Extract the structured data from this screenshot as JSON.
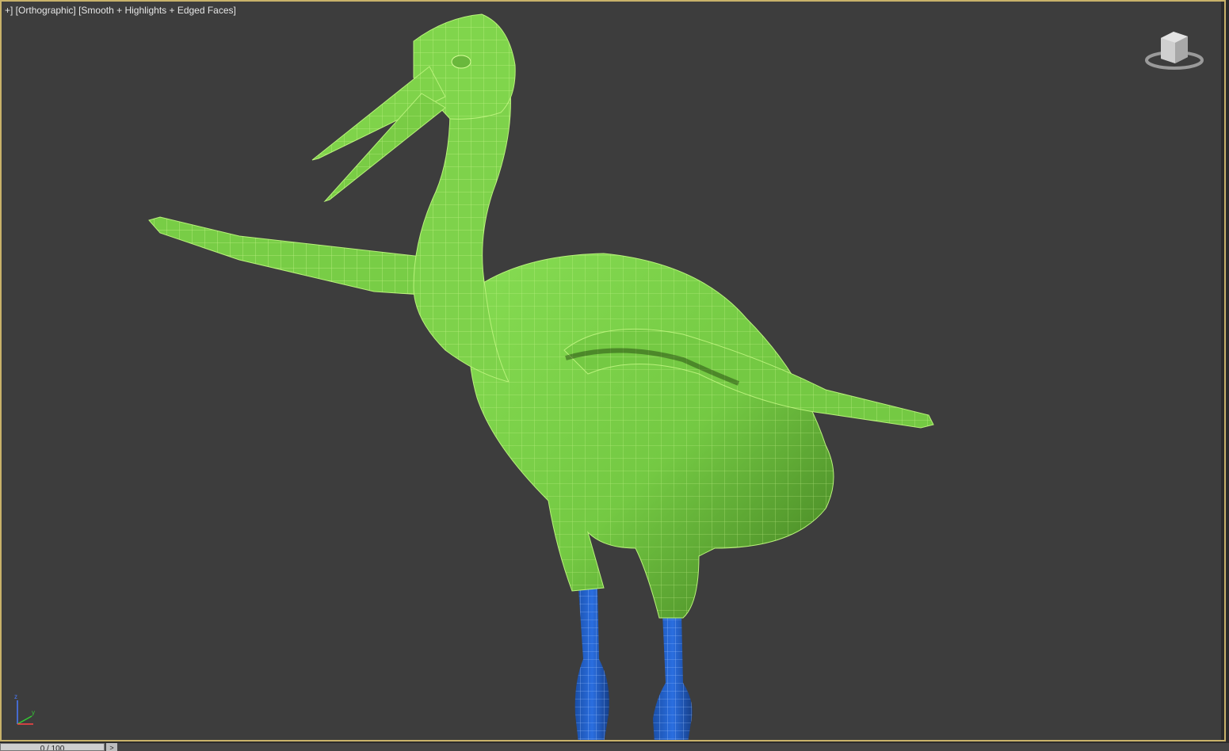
{
  "viewport": {
    "menu_plus": "+",
    "sep1": "] [",
    "view_name": "Orthographic",
    "sep2": "] [",
    "shading_mode": "Smooth + Highlights + Edged Faces",
    "close_bracket": "]"
  },
  "timeline": {
    "frame_counter": "0 / 100",
    "next_label": ">"
  },
  "colors": {
    "viewport_bg": "#3d3d3d",
    "active_border": "#c9b26a",
    "body_mesh": "#7fd34a",
    "wireframe": "#d9ff9a",
    "legs": "#1f5fbf"
  },
  "icons": [
    "viewcube-icon",
    "axis-tripod-icon"
  ]
}
